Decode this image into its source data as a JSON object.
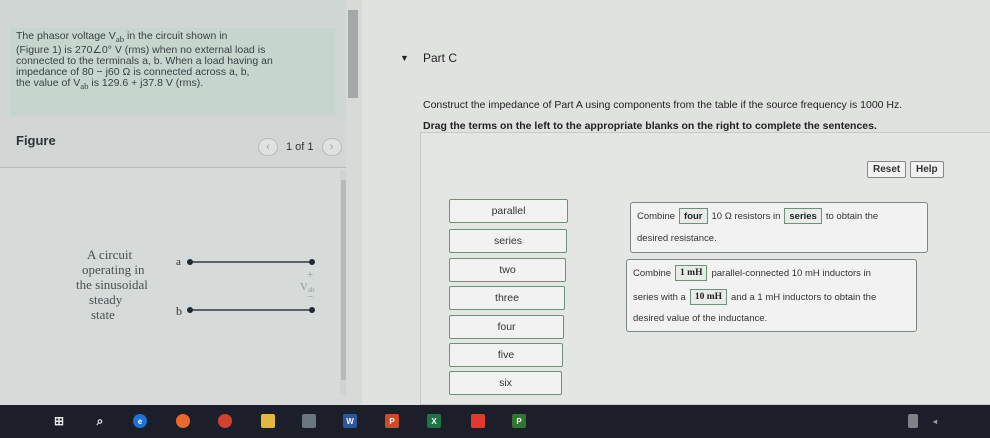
{
  "problem": {
    "line1": "The phasor voltage V",
    "line1_sub": "ab",
    "line1_end": " in the circuit shown in",
    "line2": "(Figure 1) is 270∠0° V (rms) when no external load is",
    "line3": "connected to the terminals a, b. When a load having an",
    "line4": "impedance of 80 − j60 Ω is connected across a, b,",
    "line5_start": "the value of V",
    "line5_sub": "ab",
    "line5_end": " is 129.6 + j37.8 V (rms)."
  },
  "figure": {
    "title": "Figure",
    "pager_text": "1 of 1",
    "prev_icon": "‹",
    "next_icon": "›",
    "circuit_text": [
      "A circuit",
      "operating in",
      "the sinusoidal",
      "steady",
      "state"
    ],
    "node_a": "a",
    "node_b": "b",
    "plus": "+",
    "minus": "−",
    "vlabel": "V",
    "vlabel_sub": "ab"
  },
  "part": {
    "arrow": "▼",
    "title": "Part C",
    "instruction": "Construct the impedance of Part A using components from the table if the source frequency is 1000 Hz.",
    "drag_instruction": "Drag the terms on the left to the appropriate blanks on the right to complete the sentences."
  },
  "toolbar": {
    "reset": "Reset",
    "help": "Help"
  },
  "terms": [
    "parallel",
    "series",
    "two",
    "three",
    "four",
    "five",
    "six"
  ],
  "sentence1": {
    "prefix": "Combine",
    "slot1": "four",
    "mid": "10 Ω resistors in",
    "slot2": "series",
    "suffix": "to obtain the",
    "line2": "desired resistance."
  },
  "sentence2": {
    "prefix": "Combine",
    "slot1": "1 mH",
    "mid": "parallel-connected 10 mH inductors in",
    "line2_prefix": "series with a",
    "slot2": "10 mH",
    "line2_suffix": "and a 1 mH inductors to obtain the",
    "line3": "desired value of the inductance."
  },
  "taskbar": {
    "icons": [
      "windows-start",
      "search",
      "edge",
      "firefox",
      "chrome",
      "file-explorer",
      "store",
      "word",
      "powerpoint",
      "excel",
      "acrobat",
      "project"
    ]
  }
}
